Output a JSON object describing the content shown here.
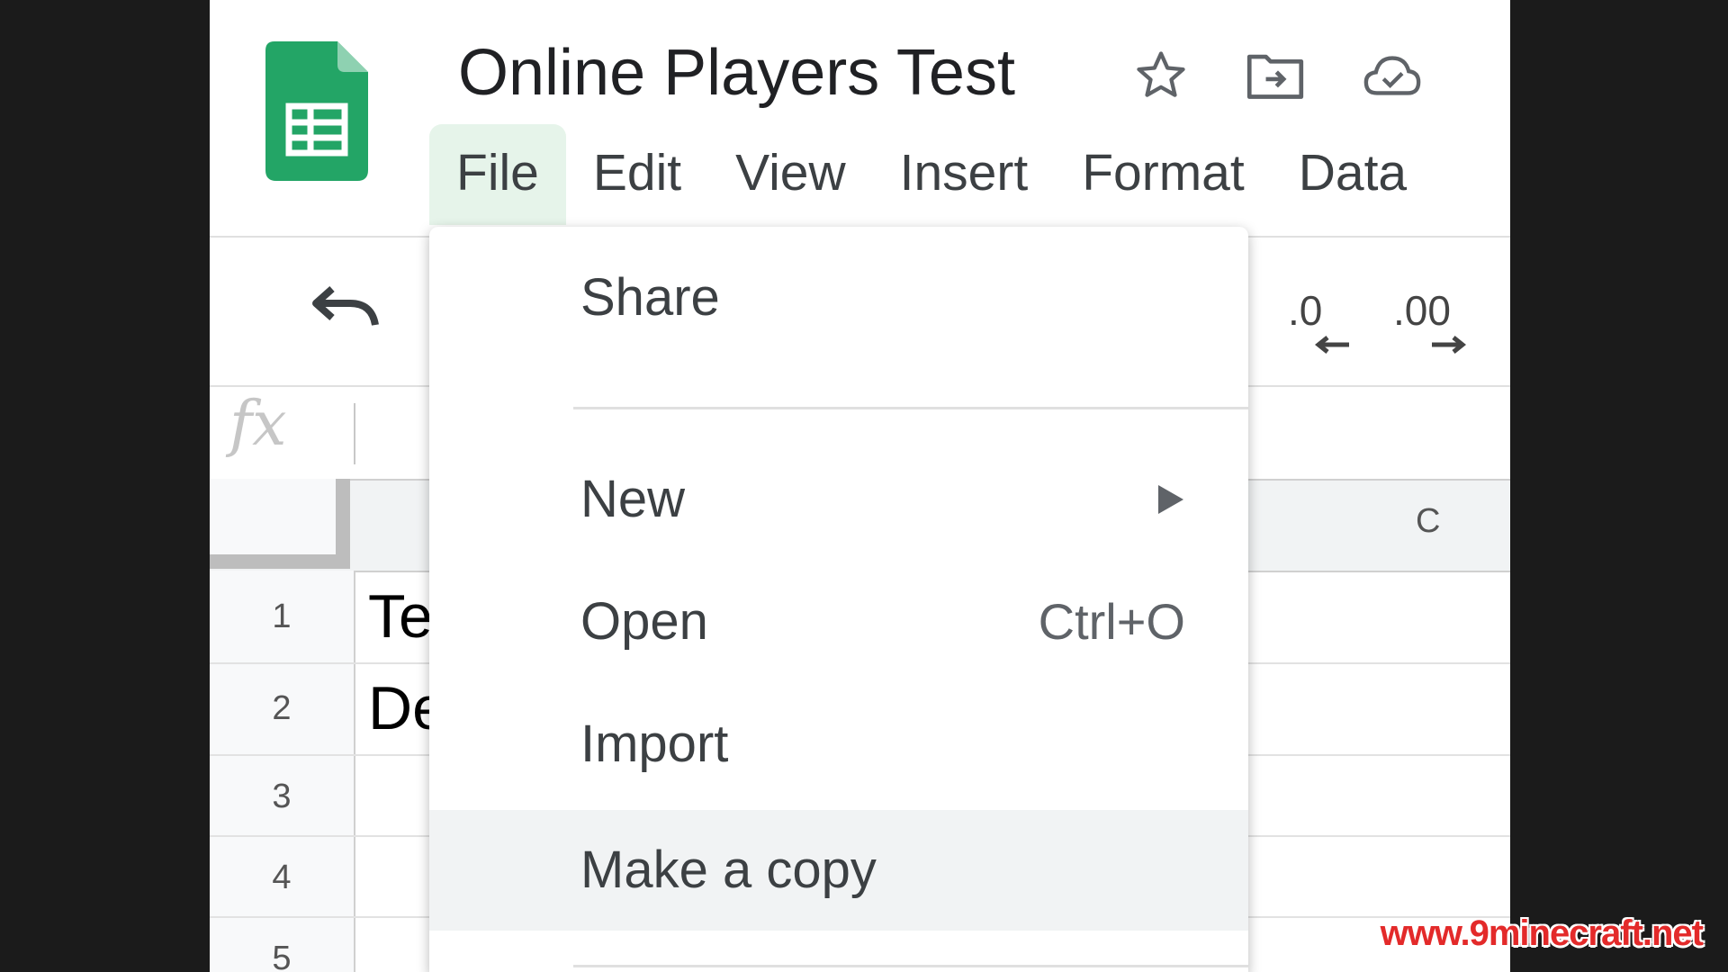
{
  "document": {
    "title": "Online Players Test"
  },
  "menubar": {
    "items": [
      "File",
      "Edit",
      "View",
      "Insert",
      "Format",
      "Data"
    ]
  },
  "toolbar": {
    "decrease_decimal_label": ".0",
    "increase_decimal_label": ".00"
  },
  "formula_bar": {
    "fx_label": "fx"
  },
  "grid": {
    "visible_column_header": "C",
    "rows": [
      {
        "number": "1",
        "cell_a": "Te"
      },
      {
        "number": "2",
        "cell_a": "De"
      },
      {
        "number": "3",
        "cell_a": ""
      },
      {
        "number": "4",
        "cell_a": ""
      },
      {
        "number": "5",
        "cell_a": ""
      }
    ]
  },
  "file_menu": {
    "share": "Share",
    "new": "New",
    "open": "Open",
    "open_shortcut": "Ctrl+O",
    "import": "Import",
    "make_copy": "Make a copy"
  },
  "watermark": {
    "text": "www.9minecraft.net"
  },
  "colors": {
    "sheets_green": "#23a566",
    "active_menu_bg": "#e6f4ea",
    "hover_bg": "#f1f3f4",
    "watermark_red": "#e32a2a"
  },
  "icons": {
    "app_logo": "google-sheets-logo-icon",
    "star": "star-icon",
    "move": "move-to-folder-icon",
    "cloud": "cloud-saved-icon",
    "undo": "undo-icon",
    "submenu": "chevron-right-icon"
  }
}
